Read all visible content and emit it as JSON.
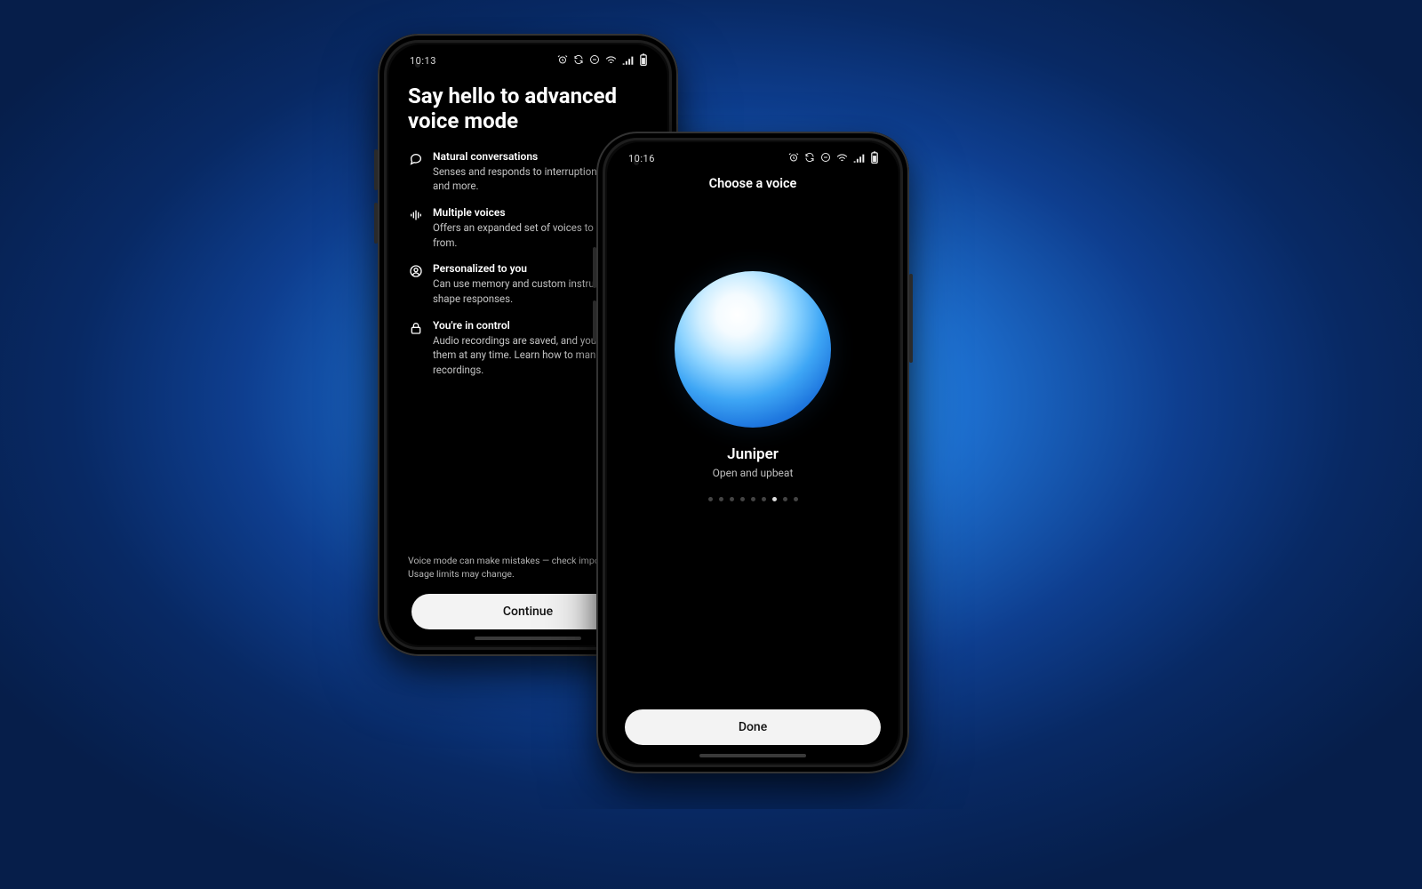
{
  "status_left": {
    "time_a": "10:13",
    "time_b": "10:16"
  },
  "intro": {
    "title": "Say hello to advanced voice mode",
    "features": [
      {
        "title": "Natural conversations",
        "desc": "Senses and responds to interruptions, humor, and more."
      },
      {
        "title": "Multiple voices",
        "desc": "Offers an expanded set of voices to choose from."
      },
      {
        "title": "Personalized to you",
        "desc": "Can use memory and custom instructions to shape responses."
      },
      {
        "title": "You're in control",
        "desc": "Audio recordings are saved, and you can delete them at any time. Learn how to manage recordings."
      }
    ],
    "disclaimer": "Voice mode can make mistakes — check important info. Usage limits may change.",
    "cta": "Continue"
  },
  "chooser": {
    "heading": "Choose a voice",
    "voice_name": "Juniper",
    "voice_desc": "Open and upbeat",
    "dots_total": 9,
    "dots_active_index": 6,
    "cta": "Done"
  }
}
